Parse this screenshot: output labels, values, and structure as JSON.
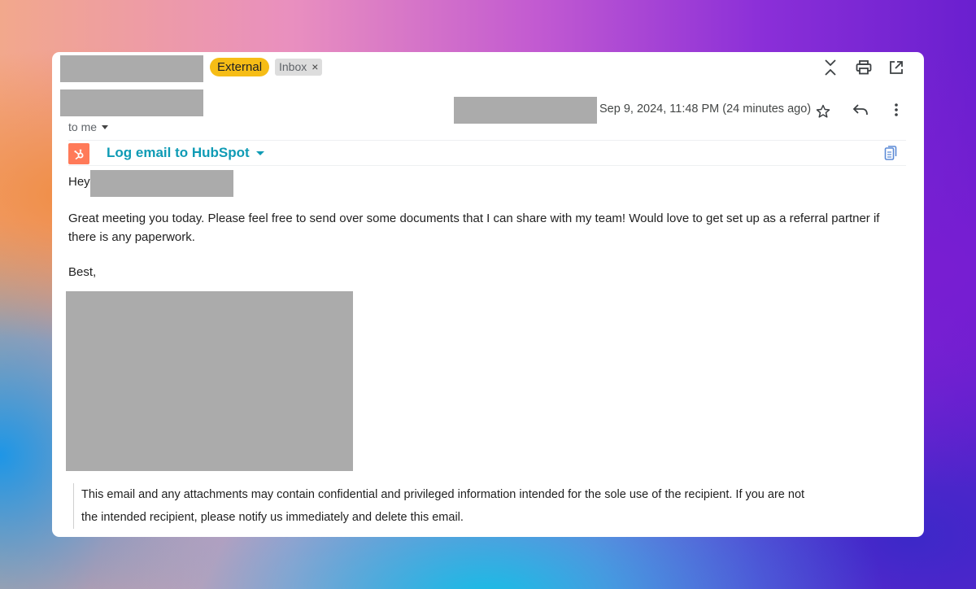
{
  "header": {
    "badges": {
      "external": "External",
      "inbox": "Inbox",
      "inbox_remove": "×"
    },
    "icons": [
      "collapse-icon",
      "print-icon",
      "open-in-new-window-icon"
    ]
  },
  "message": {
    "date": "Sep 9, 2024, 11:48 PM (24 minutes ago)",
    "to_label": "to me",
    "actions": [
      "star-icon",
      "reply-icon",
      "more-vert-icon"
    ]
  },
  "hubspot": {
    "label": "Log email to HubSpot",
    "accent": "#ff7a59",
    "link_color": "#0f9bb5"
  },
  "body": {
    "greeting": "Hey",
    "paragraph": "Great meeting you today. Please feel free to send over some documents that I can share with my team! Would love to get set up as a referral partner if there is any paperwork.",
    "closing": "Best,"
  },
  "footer": {
    "disclaimer_line1": "This email and any attachments may contain confidential and privileged information intended for the sole use of the recipient. If you are not",
    "disclaimer_line2": "the intended recipient, please notify us immediately and delete this email."
  },
  "colors": {
    "badge_external": "#f6bd16",
    "badge_inbox": "#dddddd",
    "redaction": "#ababab"
  }
}
